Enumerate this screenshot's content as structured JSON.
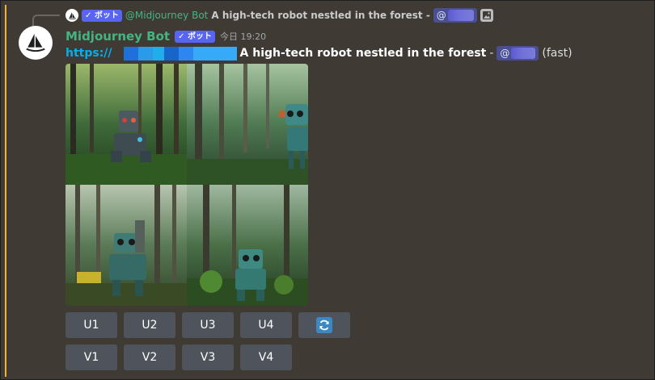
{
  "reply": {
    "badge": "✓ ボット",
    "author": "@Midjourney Bot",
    "text": "A high-tech robot nestled in the forest -",
    "mention_prefix": "@"
  },
  "message": {
    "author": "Midjourney Bot",
    "badge": "✓ ボット",
    "timestamp": "今日 19:20",
    "link_text": "https://",
    "prompt": "A high-tech robot nestled in the forest",
    "separator": "-",
    "mention_prefix": "@",
    "speed": "(fast)"
  },
  "buttons": {
    "upscale": [
      "U1",
      "U2",
      "U3",
      "U4"
    ],
    "variation": [
      "V1",
      "V2",
      "V3",
      "V4"
    ]
  },
  "icons": {
    "reroll": "reroll-icon",
    "attachment": "image-icon",
    "avatar": "midjourney-sailboat-logo"
  },
  "colors": {
    "background": "#3f3b34",
    "mention_bar": "#f0b232",
    "bot_name": "#43b581",
    "badge": "#5865f2",
    "link": "#00b0f4",
    "button": "#4f545c"
  }
}
